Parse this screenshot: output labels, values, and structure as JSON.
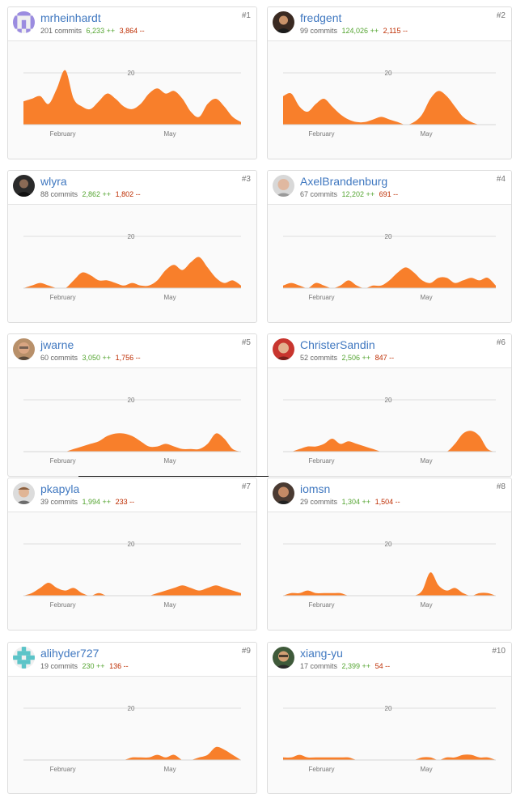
{
  "chart_data": [
    {
      "type": "area",
      "title": "",
      "y_marker": 20,
      "x_ticks": [
        "February",
        "May"
      ],
      "series": [
        {
          "values": [
            9,
            10,
            11,
            8,
            14,
            21,
            10,
            7,
            6,
            9,
            12,
            10,
            7,
            6,
            8,
            12,
            14,
            12,
            13,
            10,
            5,
            3,
            8,
            10,
            7,
            3,
            1
          ]
        }
      ]
    },
    {
      "type": "area",
      "title": "",
      "y_marker": 20,
      "x_ticks": [
        "February",
        "May"
      ],
      "series": [
        {
          "values": [
            11,
            12,
            7,
            5,
            8,
            10,
            7,
            4,
            2,
            1,
            1,
            2,
            3,
            2,
            1,
            0,
            1,
            4,
            10,
            13,
            11,
            7,
            3,
            1,
            0,
            0,
            0
          ]
        }
      ]
    },
    {
      "type": "area",
      "title": "",
      "y_marker": 20,
      "x_ticks": [
        "February",
        "May"
      ],
      "series": [
        {
          "values": [
            0,
            1,
            2,
            1,
            0,
            0,
            3,
            6,
            5,
            3,
            3,
            2,
            1,
            2,
            1,
            1,
            3,
            7,
            9,
            7,
            10,
            12,
            8,
            4,
            2,
            3,
            1
          ]
        }
      ]
    },
    {
      "type": "area",
      "title": "",
      "y_marker": 20,
      "x_ticks": [
        "February",
        "May"
      ],
      "series": [
        {
          "values": [
            1,
            2,
            1,
            0,
            2,
            1,
            0,
            1,
            3,
            1,
            0,
            1,
            1,
            3,
            6,
            8,
            6,
            3,
            2,
            4,
            4,
            2,
            3,
            4,
            3,
            4,
            1
          ]
        }
      ]
    },
    {
      "type": "area",
      "title": "",
      "y_marker": 20,
      "x_ticks": [
        "February",
        "May"
      ],
      "series": [
        {
          "values": [
            0,
            0,
            0,
            0,
            0,
            0,
            1,
            2,
            3,
            4,
            6,
            7,
            7,
            6,
            4,
            2,
            2,
            3,
            2,
            1,
            1,
            1,
            3,
            7,
            5,
            1,
            0
          ]
        }
      ]
    },
    {
      "type": "area",
      "title": "",
      "y_marker": 20,
      "x_ticks": [
        "February",
        "May"
      ],
      "series": [
        {
          "values": [
            0,
            0,
            1,
            2,
            2,
            3,
            5,
            3,
            4,
            3,
            2,
            1,
            0,
            0,
            0,
            0,
            0,
            0,
            0,
            0,
            0,
            3,
            7,
            8,
            6,
            1,
            0
          ]
        }
      ]
    },
    {
      "type": "area",
      "title": "",
      "y_marker": 20,
      "x_ticks": [
        "February",
        "May"
      ],
      "series": [
        {
          "values": [
            0,
            1,
            3,
            5,
            3,
            2,
            3,
            1,
            0,
            1,
            0,
            0,
            0,
            0,
            0,
            0,
            1,
            2,
            3,
            4,
            3,
            2,
            3,
            4,
            3,
            2,
            1
          ]
        }
      ]
    },
    {
      "type": "area",
      "title": "",
      "y_marker": 20,
      "x_ticks": [
        "February",
        "May"
      ],
      "series": [
        {
          "values": [
            0,
            1,
            1,
            2,
            1,
            1,
            1,
            1,
            0,
            0,
            0,
            0,
            0,
            0,
            0,
            0,
            0,
            2,
            9,
            4,
            2,
            3,
            1,
            0,
            1,
            1,
            0
          ]
        }
      ]
    },
    {
      "type": "area",
      "title": "",
      "y_marker": 20,
      "x_ticks": [
        "February",
        "May"
      ],
      "series": [
        {
          "values": [
            0,
            0,
            0,
            0,
            0,
            0,
            0,
            0,
            0,
            0,
            0,
            0,
            0,
            1,
            1,
            1,
            2,
            1,
            2,
            0,
            0,
            1,
            2,
            5,
            4,
            2,
            0
          ]
        }
      ]
    },
    {
      "type": "area",
      "title": "",
      "y_marker": 20,
      "x_ticks": [
        "February",
        "May"
      ],
      "series": [
        {
          "values": [
            1,
            1,
            2,
            1,
            1,
            1,
            1,
            1,
            1,
            0,
            0,
            0,
            0,
            0,
            0,
            0,
            0,
            1,
            1,
            0,
            1,
            1,
            2,
            2,
            1,
            1,
            0
          ]
        }
      ]
    }
  ],
  "contributors": [
    {
      "username": "mrheinhardt",
      "commits": "201 commits",
      "additions": "6,233 ++",
      "deletions": "3,864 --",
      "rank": "#1",
      "avatar": "identicon-purple-icon"
    },
    {
      "username": "fredgent",
      "commits": "99 commits",
      "additions": "124,026 ++",
      "deletions": "2,115 --",
      "rank": "#2",
      "avatar": "avatar-photo-dark-icon"
    },
    {
      "username": "wlyra",
      "commits": "88 commits",
      "additions": "2,862 ++",
      "deletions": "1,802 --",
      "rank": "#3",
      "avatar": "avatar-photo-dark-icon"
    },
    {
      "username": "AxelBrandenburg",
      "commits": "67 commits",
      "additions": "12,202 ++",
      "deletions": "691 --",
      "rank": "#4",
      "avatar": "avatar-photo-light-icon"
    },
    {
      "username": "jwarne",
      "commits": "60 commits",
      "additions": "3,050 ++",
      "deletions": "1,756 --",
      "rank": "#5",
      "avatar": "avatar-photo-icon"
    },
    {
      "username": "ChristerSandin",
      "commits": "52 commits",
      "additions": "2,506 ++",
      "deletions": "847 --",
      "rank": "#6",
      "avatar": "avatar-photo-red-icon"
    },
    {
      "username": "pkapyla",
      "commits": "39 commits",
      "additions": "1,994 ++",
      "deletions": "233 --",
      "rank": "#7",
      "avatar": "avatar-photo-icon"
    },
    {
      "username": "iomsn",
      "commits": "29 commits",
      "additions": "1,304 ++",
      "deletions": "1,504 --",
      "rank": "#8",
      "avatar": "avatar-photo-dark-icon"
    },
    {
      "username": "alihyder727",
      "commits": "19 commits",
      "additions": "230 ++",
      "deletions": "136 --",
      "rank": "#9",
      "avatar": "identicon-teal-icon"
    },
    {
      "username": "xiang-yu",
      "commits": "17 commits",
      "additions": "2,399 ++",
      "deletions": "54 --",
      "rank": "#10",
      "avatar": "avatar-photo-icon"
    }
  ],
  "colors": {
    "area": "#f87f2b",
    "link": "#4078c0",
    "additions": "#55a532",
    "deletions": "#bd2c00"
  }
}
